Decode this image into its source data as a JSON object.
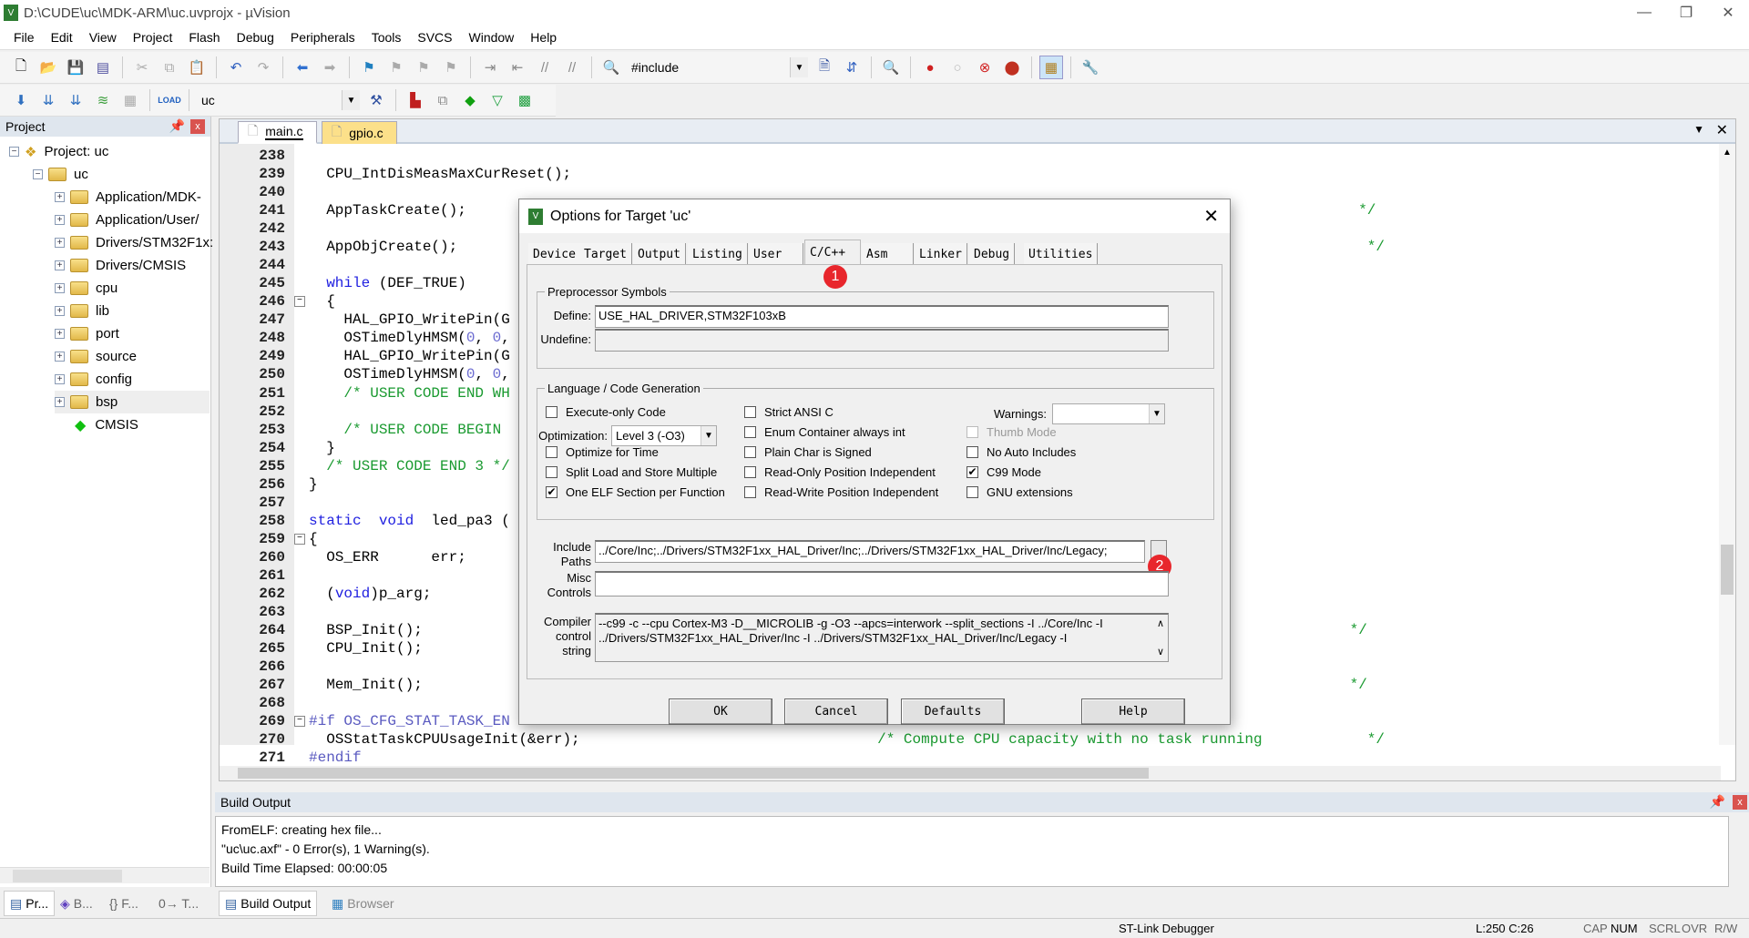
{
  "window": {
    "title": "D:\\CUDE\\uc\\MDK-ARM\\uc.uvprojx - µVision",
    "controls": [
      "—",
      "❐",
      "✕"
    ]
  },
  "menu": [
    "File",
    "Edit",
    "View",
    "Project",
    "Flash",
    "Debug",
    "Peripherals",
    "Tools",
    "SVCS",
    "Window",
    "Help"
  ],
  "toolbar": {
    "find_combo": "#include",
    "target_combo": "uc"
  },
  "project": {
    "title": "Project",
    "root": "Project: uc",
    "target": "uc",
    "groups": [
      "Application/MDK-",
      "Application/User/",
      "Drivers/STM32F1x:",
      "Drivers/CMSIS",
      "cpu",
      "lib",
      "port",
      "source",
      "config",
      "bsp"
    ],
    "component": "CMSIS",
    "selected": "bsp"
  },
  "editor": {
    "tabs": [
      {
        "label": "main.c",
        "active": true
      },
      {
        "label": "gpio.c",
        "active": false
      }
    ],
    "lines": [
      {
        "n": "238",
        "t": []
      },
      {
        "n": "239",
        "t": [
          [
            "  CPU_IntDisMeasMaxCurReset();",
            ""
          ]
        ]
      },
      {
        "n": "240",
        "t": []
      },
      {
        "n": "241",
        "t": [
          [
            "  AppTaskCreate();",
            ""
          ],
          [
            "                                                                                                      */",
            "cm"
          ]
        ]
      },
      {
        "n": "242",
        "t": []
      },
      {
        "n": "243",
        "t": [
          [
            "  AppObjCreate();",
            ""
          ],
          [
            "                                                                                                        */",
            "cm"
          ]
        ]
      },
      {
        "n": "244",
        "t": []
      },
      {
        "n": "245",
        "t": [
          [
            "  ",
            ""
          ],
          [
            "while",
            "kw"
          ],
          [
            " (DEF_TRUE)",
            ""
          ]
        ]
      },
      {
        "n": "246",
        "t": [
          [
            "  {",
            ""
          ]
        ],
        "fold": "−"
      },
      {
        "n": "247",
        "t": [
          [
            "    HAL_GPIO_WritePin(G",
            ""
          ]
        ]
      },
      {
        "n": "248",
        "t": [
          [
            "    OSTimeDlyHMSM(",
            ""
          ],
          [
            "0",
            "nm"
          ],
          [
            ", ",
            ""
          ],
          [
            "0",
            "nm"
          ],
          [
            ",",
            ""
          ]
        ]
      },
      {
        "n": "249",
        "t": [
          [
            "    HAL_GPIO_WritePin(G",
            ""
          ]
        ]
      },
      {
        "n": "250",
        "t": [
          [
            "    OSTimeDlyHMSM(",
            ""
          ],
          [
            "0",
            "nm"
          ],
          [
            ", ",
            ""
          ],
          [
            "0",
            "nm"
          ],
          [
            ",",
            ""
          ]
        ]
      },
      {
        "n": "251",
        "t": [
          [
            "    /* USER CODE END WH",
            "cm"
          ]
        ]
      },
      {
        "n": "252",
        "t": []
      },
      {
        "n": "253",
        "t": [
          [
            "    /* USER CODE BEGIN ",
            "cm"
          ]
        ]
      },
      {
        "n": "254",
        "t": [
          [
            "  }",
            ""
          ]
        ]
      },
      {
        "n": "255",
        "t": [
          [
            "  /* USER CODE END 3 */",
            "cm"
          ]
        ]
      },
      {
        "n": "256",
        "t": [
          [
            "}",
            ""
          ]
        ]
      },
      {
        "n": "257",
        "t": []
      },
      {
        "n": "258",
        "t": [
          [
            "static",
            "kw"
          ],
          [
            "  ",
            ""
          ],
          [
            "void",
            "kw"
          ],
          [
            "  led_pa3 (",
            ""
          ]
        ]
      },
      {
        "n": "259",
        "t": [
          [
            "{",
            ""
          ]
        ],
        "fold": "−"
      },
      {
        "n": "260",
        "t": [
          [
            "  OS_ERR      err;",
            ""
          ]
        ]
      },
      {
        "n": "261",
        "t": []
      },
      {
        "n": "262",
        "t": [
          [
            "  (",
            ""
          ],
          [
            "void",
            "kw"
          ],
          [
            ")p_arg;",
            ""
          ]
        ]
      },
      {
        "n": "263",
        "t": []
      },
      {
        "n": "264",
        "t": [
          [
            "  BSP_Init();",
            ""
          ],
          [
            "                                                                                                          */",
            "cm"
          ]
        ]
      },
      {
        "n": "265",
        "t": [
          [
            "  CPU_Init();",
            ""
          ]
        ]
      },
      {
        "n": "266",
        "t": []
      },
      {
        "n": "267",
        "t": [
          [
            "  Mem_Init();",
            ""
          ],
          [
            "                                                                                                          */",
            "cm"
          ]
        ]
      },
      {
        "n": "268",
        "t": []
      },
      {
        "n": "269",
        "t": [
          [
            "#if OS_CFG_STAT_TASK_EN",
            "pp"
          ]
        ],
        "fold": "−"
      },
      {
        "n": "270",
        "t": [
          [
            "  OSStatTaskCPUUsageInit(&err);",
            ""
          ],
          [
            "                                  /* Compute CPU capacity with no task running",
            "cm"
          ],
          [
            "            */",
            "cm"
          ]
        ]
      },
      {
        "n": "271",
        "t": [
          [
            "#endif",
            "pp"
          ]
        ]
      }
    ]
  },
  "build": {
    "title": "Build Output",
    "lines": [
      "FromELF: creating hex file...",
      "\"uc\\uc.axf\" - 0 Error(s), 1 Warning(s).",
      "Build Time Elapsed:  00:00:05"
    ]
  },
  "bottom_tabs_left": [
    "Pr...",
    "B...",
    "{} F...",
    "0→ T..."
  ],
  "bottom_tabs": [
    "Build Output",
    "Browser"
  ],
  "status": {
    "debugger": "ST-Link Debugger",
    "position": "L:250 C:26",
    "caps": "CAP",
    "num": "NUM",
    "scrl": "SCRL",
    "ovr": "OVR",
    "rw": "R/W"
  },
  "dialog": {
    "title": "Options for Target 'uc'",
    "tabs": [
      "Device",
      "Target",
      "Output",
      "Listing",
      "User",
      "C/C++",
      "Asm",
      "Linker",
      "Debug",
      "Utilities"
    ],
    "active_tab": "C/C++",
    "pre": {
      "legend": "Preprocessor Symbols",
      "define_label": "Define:",
      "define": "USE_HAL_DRIVER,STM32F103xB",
      "undefine_label": "Undefine:",
      "undefine": ""
    },
    "lang": {
      "legend": "Language / Code Generation",
      "execute_only": {
        "label": "Execute-only Code",
        "checked": false
      },
      "optimization_label": "Optimization:",
      "optimization": "Level 3 (-O3)",
      "optimize_time": {
        "label": "Optimize for Time",
        "checked": false
      },
      "split_load": {
        "label": "Split Load and Store Multiple",
        "checked": false
      },
      "one_elf": {
        "label": "One ELF Section per Function",
        "checked": true
      },
      "strict_ansi": {
        "label": "Strict ANSI C",
        "checked": false
      },
      "enum_container": {
        "label": "Enum Container always int",
        "checked": false
      },
      "plain_char": {
        "label": "Plain Char is Signed",
        "checked": false
      },
      "ro_pi": {
        "label": "Read-Only Position Independent",
        "checked": false
      },
      "rw_pi": {
        "label": "Read-Write Position Independent",
        "checked": false
      },
      "warnings_label": "Warnings:",
      "warnings": "",
      "thumb": {
        "label": "Thumb Mode",
        "checked": false,
        "disabled": true
      },
      "no_auto": {
        "label": "No Auto Includes",
        "checked": false
      },
      "c99": {
        "label": "C99 Mode",
        "checked": true
      },
      "gnu": {
        "label": "GNU extensions",
        "checked": false
      }
    },
    "include_label": "Include Paths",
    "include": "../Core/Inc;../Drivers/STM32F1xx_HAL_Driver/Inc;../Drivers/STM32F1xx_HAL_Driver/Inc/Legacy;",
    "misc_label": "Misc Controls",
    "misc": "",
    "compiler_label": "Compiler control string",
    "compiler": "--c99 -c --cpu Cortex-M3 -D__MICROLIB -g -O3 --apcs=interwork --split_sections -I ../Core/Inc -I ../Drivers/STM32F1xx_HAL_Driver/Inc -I ../Drivers/STM32F1xx_HAL_Driver/Inc/Legacy -I",
    "buttons": {
      "ok": "OK",
      "cancel": "Cancel",
      "defaults": "Defaults",
      "help": "Help"
    },
    "annotations": [
      "1",
      "2"
    ]
  },
  "colors": {
    "badge": "#e8262c",
    "keyword": "#2020e0",
    "comment": "#1a9a30"
  }
}
